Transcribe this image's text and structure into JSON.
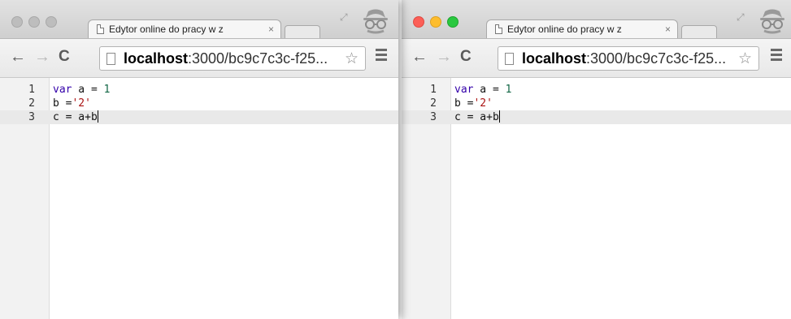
{
  "windows": [
    {
      "id": "left",
      "traffic_lights": "inactive",
      "tab": {
        "title": "Edytor online do pracy w z",
        "close_label": "×"
      },
      "toolbar": {
        "back_icon": "←",
        "forward_icon": "→",
        "reload_icon": "C",
        "url_host": "localhost",
        "url_path": ":3000/bc9c7c3c-f25...",
        "bookmark_icon": "☆"
      },
      "editor": {
        "lines": [
          {
            "number": "1",
            "tokens": [
              {
                "t": "var",
                "c": "kw"
              },
              {
                "t": " a = "
              },
              {
                "t": "1",
                "c": "num"
              }
            ]
          },
          {
            "number": "2",
            "tokens": [
              {
                "t": "b ="
              },
              {
                "t": "'2'",
                "c": "str"
              }
            ]
          },
          {
            "number": "3",
            "tokens": [
              {
                "t": "c = a+b"
              }
            ],
            "active": true
          }
        ]
      }
    },
    {
      "id": "right",
      "traffic_lights": "active",
      "tab": {
        "title": "Edytor online do pracy w z",
        "close_label": "×"
      },
      "toolbar": {
        "back_icon": "←",
        "forward_icon": "→",
        "reload_icon": "C",
        "url_host": "localhost",
        "url_path": ":3000/bc9c7c3c-f25...",
        "bookmark_icon": "☆"
      },
      "editor": {
        "lines": [
          {
            "number": "1",
            "tokens": [
              {
                "t": "var",
                "c": "kw"
              },
              {
                "t": " a = "
              },
              {
                "t": "1",
                "c": "num"
              }
            ]
          },
          {
            "number": "2",
            "tokens": [
              {
                "t": "b ="
              },
              {
                "t": "'2'",
                "c": "str"
              }
            ]
          },
          {
            "number": "3",
            "tokens": [
              {
                "t": "c = a+b"
              }
            ],
            "active": true
          }
        ]
      }
    }
  ],
  "colors": {
    "keyword": "#3300aa",
    "number": "#116644",
    "string": "#aa1111",
    "active_line": "#e9e9e9"
  }
}
